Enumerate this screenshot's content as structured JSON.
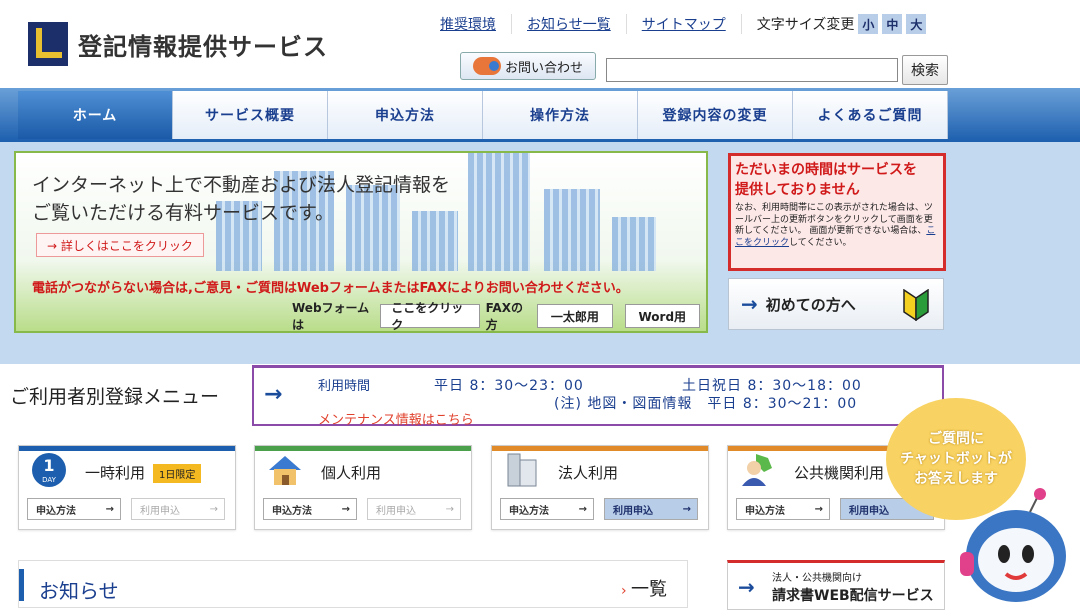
{
  "header": {
    "logo_text": "登記情報提供サービス",
    "util_links": [
      "推奨環境",
      "お知らせ一覧",
      "サイトマップ"
    ],
    "font_size_label": "文字サイズ変更",
    "font_sizes": [
      "小",
      "中",
      "大"
    ],
    "contact_label": "お問い合わせ",
    "search_value": "",
    "search_button": "検索"
  },
  "nav": {
    "tabs": [
      "ホーム",
      "サービス概要",
      "申込方法",
      "操作方法",
      "登録内容の変更",
      "よくあるご質問"
    ],
    "active_index": 0
  },
  "hero": {
    "headline": "インターネット上で不動産および法人登記情報を\nご覧いただける有料サービスです。",
    "detail_link": "→ 詳しくはここをクリック",
    "notice": "電話がつながらない場合は,ご意見・ご質問はWebフォームまたはFAXによりお問い合わせください。",
    "webform_label": "Webフォームは",
    "webform_button": "ここをクリック",
    "fax_label": "FAXの方",
    "fax_buttons": [
      "一太郎用",
      "Word用"
    ]
  },
  "status": {
    "title": "ただいまの時間はサービスを\n提供しておりません",
    "note_before": "なお、利用時間帯にこの表示がされた場合は、ツールバー上の更新ボタンをクリックして画面を更新してください。\n画面が更新できない場合は、",
    "note_link": "ここをクリック",
    "note_after": "してください。"
  },
  "first_time": {
    "label": "初めての方へ"
  },
  "menu": {
    "title": "ご利用者別登録メニュー",
    "hours_label": "利用時間",
    "weekday": "平日 8：30～23：00",
    "holiday": "土日祝日 8：30～18：00",
    "map_hours": "(注) 地図・図面情報　平日 8：30～21：00",
    "maintenance_link": "メンテナンス情報はこちら"
  },
  "cards": [
    {
      "title": "一時利用",
      "badge": "1日限定",
      "apply_method": "申込方法",
      "use_apply": "利用申込",
      "enabled": false,
      "accent": "#1d5fae"
    },
    {
      "title": "個人利用",
      "badge": "",
      "apply_method": "申込方法",
      "use_apply": "利用申込",
      "enabled": false,
      "accent": "#4ba04b"
    },
    {
      "title": "法人利用",
      "badge": "",
      "apply_method": "申込方法",
      "use_apply": "利用申込",
      "enabled": true,
      "accent": "#e08a2a"
    },
    {
      "title": "公共機関利用",
      "badge": "",
      "apply_method": "申込方法",
      "use_apply": "利用申込",
      "enabled": true,
      "accent": "#e08a2a"
    }
  ],
  "news": {
    "title": "お知らせ",
    "all_link": "一覧"
  },
  "invoice": {
    "sub": "法人・公共機関向け",
    "main": "請求書WEB配信サービス"
  },
  "chatbot": {
    "bubble": "ご質問に\nチャットボットが\nお答えします"
  },
  "day_icon": {
    "number": "1",
    "unit": "DAY"
  },
  "colors": {
    "brand": "#1d2f6a",
    "nav": "#1d5fae",
    "alert": "#d42b2b",
    "band": "#c2d9ef"
  }
}
